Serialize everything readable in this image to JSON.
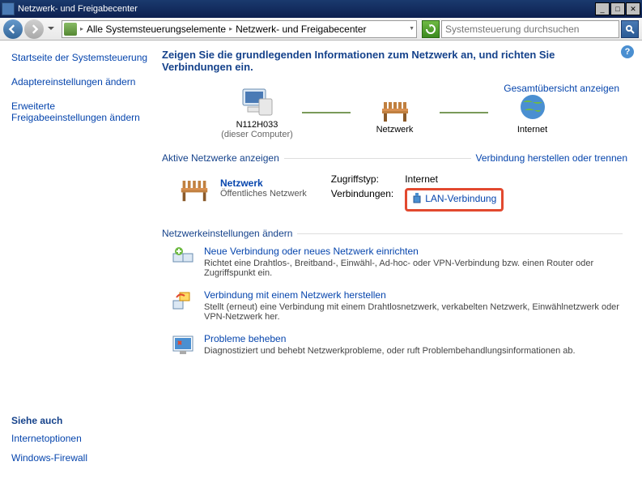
{
  "window": {
    "title": "Netzwerk- und Freigabecenter"
  },
  "breadcrumb": {
    "seg1": "Alle Systemsteuerungselemente",
    "seg2": "Netzwerk- und Freigabecenter"
  },
  "search": {
    "placeholder": "Systemsteuerung durchsuchen"
  },
  "sidebar": {
    "home": "Startseite der Systemsteuerung",
    "adapter": "Adaptereinstellungen ändern",
    "advanced": "Erweiterte Freigabeeinstellungen ändern",
    "see_also_heading": "Siehe auch",
    "inetopt": "Internetoptionen",
    "firewall": "Windows-Firewall"
  },
  "main": {
    "heading": "Zeigen Sie die grundlegenden Informationen zum Netzwerk an, und richten Sie Verbindungen ein.",
    "full_map": "Gesamtübersicht anzeigen"
  },
  "map": {
    "computer": "N112H033",
    "computer_sub": "(dieser Computer)",
    "network": "Netzwerk",
    "internet": "Internet"
  },
  "active": {
    "section": "Aktive Netzwerke anzeigen",
    "connect_link": "Verbindung herstellen oder trennen",
    "net_name": "Netzwerk",
    "net_type": "Öffentliches Netzwerk",
    "access_label": "Zugriffstyp:",
    "access_value": "Internet",
    "conn_label": "Verbindungen:",
    "conn_value": "LAN-Verbindung"
  },
  "settings": {
    "section": "Netzwerkeinstellungen ändern",
    "item1_title": "Neue Verbindung oder neues Netzwerk einrichten",
    "item1_desc": "Richtet eine Drahtlos-, Breitband-, Einwähl-, Ad-hoc- oder VPN-Verbindung bzw. einen Router oder Zugriffspunkt ein.",
    "item2_title": "Verbindung mit einem Netzwerk herstellen",
    "item2_desc": "Stellt (erneut) eine Verbindung mit einem Drahtlosnetzwerk, verkabelten Netzwerk, Einwählnetzwerk oder VPN-Netzwerk her.",
    "item3_title": "Probleme beheben",
    "item3_desc": "Diagnostiziert und behebt Netzwerkprobleme, oder ruft Problembehandlungsinformationen ab."
  }
}
